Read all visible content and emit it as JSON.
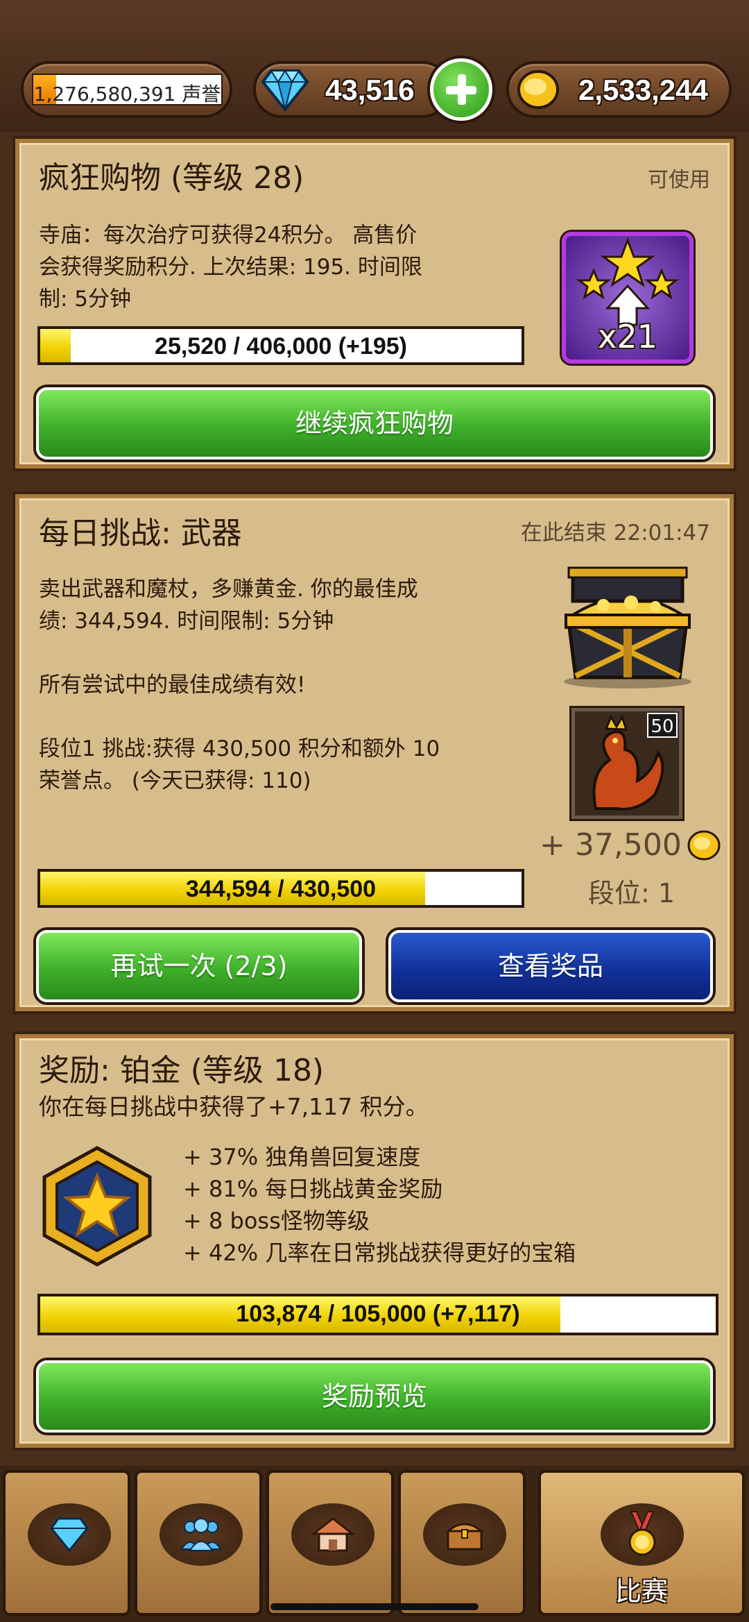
{
  "topbar": {
    "honor_text": "1,276,580,391 声誉",
    "honor_progress": 0.12,
    "gems": "43,516",
    "gold": "2,533,244"
  },
  "shopping": {
    "title": "疯狂购物 (等级 28)",
    "status": "可使用",
    "desc_line1": "寺庙：每次治疗可获得24积分。 高售价",
    "desc_line2": "会获得奖励积分. 上次结果: 195. 时间限",
    "desc_line3": "制: 5分钟",
    "bar_text": "25,520 / 406,000 (+195)",
    "bar_progress": 0.063,
    "badge_text": "x21",
    "button": "继续疯狂购物"
  },
  "daily": {
    "title": "每日挑战: 武器",
    "ends": "在此结束 22:01:47",
    "desc_line1": "卖出武器和魔杖，多赚黄金. 你的最佳成",
    "desc_line2": "绩: 344,594. 时间限制: 5分钟",
    "desc_line3": "所有尝试中的最佳成绩有效!",
    "desc_line4": "段位1 挑战:获得 430,500 积分和额外 10",
    "desc_line5": "荣誉点。 (今天已获得: 110)",
    "card_level": "50",
    "reward_gold": "+ 37,500",
    "rank": "段位: 1",
    "bar_text": "344,594 / 430,500",
    "bar_progress": 0.8,
    "retry_button": "再试一次 (2/3)",
    "prizes_button": "查看奖品"
  },
  "reward": {
    "title": "奖励: 铂金 (等级 18)",
    "subtitle": "你在每日挑战中获得了+7,117 积分。",
    "perk1": "+ 37% 独角兽回复速度",
    "perk2": "+ 81% 每日挑战黄金奖励",
    "perk3": "+ 8 boss怪物等级",
    "perk4": "+ 42% 几率在日常挑战获得更好的宝箱",
    "bar_text": "103,874 / 105,000 (+7,117)",
    "bar_progress": 0.77,
    "button": "奖励预览"
  },
  "nav": {
    "active_label": "比赛"
  }
}
